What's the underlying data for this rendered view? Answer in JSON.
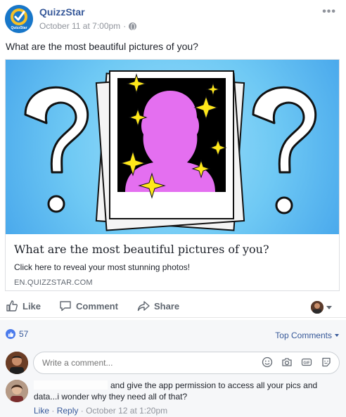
{
  "post": {
    "page_name": "QuizzStar",
    "logo_text": "QuizzStar",
    "timestamp": "October 11 at 7:00pm",
    "separator": "·",
    "privacy_icon": "globe-icon",
    "more_icon": "more-options-icon",
    "text": "What are the most beautiful pictures of you?"
  },
  "link_card": {
    "title": "What are the most beautiful pictures of you?",
    "description": "Click here to reveal your most stunning photos!",
    "domain": "EN.QUIZZSTAR.COM"
  },
  "actions": {
    "like": "Like",
    "comment": "Comment",
    "share": "Share"
  },
  "reactions": {
    "count": "57",
    "sort_label": "Top Comments"
  },
  "composer": {
    "placeholder": "Write a comment..."
  },
  "comment": {
    "text": "and give the app permission to access all your pics and data...i wonder why they need all of that?",
    "like": "Like",
    "reply": "Reply",
    "dot": "·",
    "time": "October 12 at 1:20pm"
  },
  "colors": {
    "link_blue": "#365899",
    "meta_gray": "#90949c",
    "sky_blue": "#6fc9f4",
    "silhouette_pink": "#e46ff0",
    "sparkle_yellow": "#ffe81a"
  }
}
